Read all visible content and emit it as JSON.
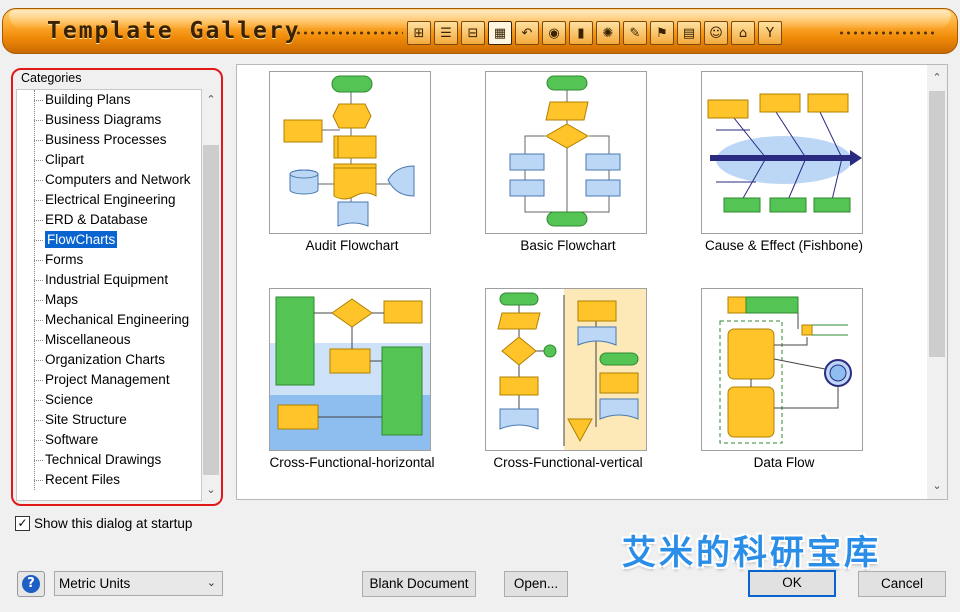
{
  "window": {
    "title": "Template Gallery"
  },
  "toolbar": {
    "icons": [
      "hierarchy-icon",
      "list-icon",
      "tree-icon",
      "grid-icon",
      "curve-icon",
      "lightbulb-icon",
      "bar-chart-icon",
      "sun-icon",
      "pen-icon",
      "flag-icon",
      "table-icon",
      "people-icon",
      "building-icon",
      "branch-icon"
    ],
    "glyphs": [
      "⊞",
      "☰",
      "⊟",
      "▦",
      "↶",
      "◉",
      "▮",
      "✺",
      "✎",
      "⚑",
      "▤",
      "☺",
      "⌂",
      "Y"
    ],
    "active_index": 3
  },
  "categories": {
    "header": "Categories",
    "items": [
      "Building Plans",
      "Business Diagrams",
      "Business Processes",
      "Clipart",
      "Computers and Network",
      "Electrical Engineering",
      "ERD & Database",
      "FlowCharts",
      "Forms",
      "Industrial Equipment",
      "Maps",
      "Mechanical Engineering",
      "Miscellaneous",
      "Organization Charts",
      "Project Management",
      "Science",
      "Site Structure",
      "Software",
      "Technical Drawings",
      "Recent Files"
    ],
    "selected": "FlowCharts"
  },
  "templates": [
    {
      "label": "Audit Flowchart"
    },
    {
      "label": "Basic Flowchart"
    },
    {
      "label": "Cause & Effect (Fishbone)"
    },
    {
      "label": "Cross-Functional-horizontal"
    },
    {
      "label": "Cross-Functional-vertical"
    },
    {
      "label": "Data Flow"
    }
  ],
  "startup": {
    "label": "Show this dialog at startup",
    "checked": true
  },
  "units": {
    "value": "Metric Units"
  },
  "buttons": {
    "blank": "Blank Document",
    "open": "Open...",
    "ok": "OK",
    "cancel": "Cancel"
  },
  "watermark": "艾米的科研宝库",
  "colors": {
    "accent": "#0a64d0",
    "title_bar": "#f08a08",
    "highlight": "#e01818"
  }
}
